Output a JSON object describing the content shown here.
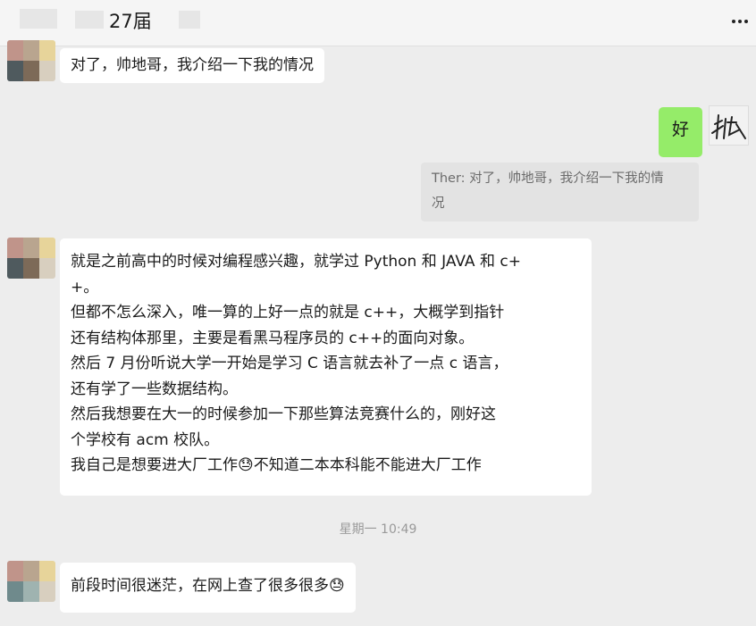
{
  "header": {
    "title": "27届",
    "more_icon": "more-horizontal-icon"
  },
  "messages": [
    {
      "sender": "other",
      "text": "对了，帅地哥，我介绍一下我的情况"
    },
    {
      "sender": "me",
      "text": "好"
    },
    {
      "sender": "me",
      "type": "quote",
      "text": "Ther: 对了，帅地哥，我介绍一下我的情\n况"
    },
    {
      "sender": "other",
      "text": "就是之前高中的时候对编程感兴趣，就学过 Python 和 JAVA 和 c+\n+。\n但都不怎么深入，唯一算的上好一点的就是 c++，大概学到指针\n还有结构体那里，主要是看黑马程序员的 c++的面向对象。\n然后 7 月份听说大学一开始是学习 C 语言就去补了一点 c 语言，\n还有学了一些数据结构。\n然后我想要在大一的时候参加一下那些算法竞赛什么的，刚好这\n个学校有 acm 校队。\n我自己是想要进大厂工作😓不知道二本本科能不能进大厂工作"
    },
    {
      "type": "timestamp",
      "text": "星期一 10:49"
    },
    {
      "sender": "other",
      "text": "前段时间很迷茫，在网上查了很多很多😓"
    }
  ],
  "colors": {
    "background": "#ededed",
    "bubble_other": "#ffffff",
    "bubble_me": "#95ec69",
    "quote_bg": "#e3e3e3"
  }
}
